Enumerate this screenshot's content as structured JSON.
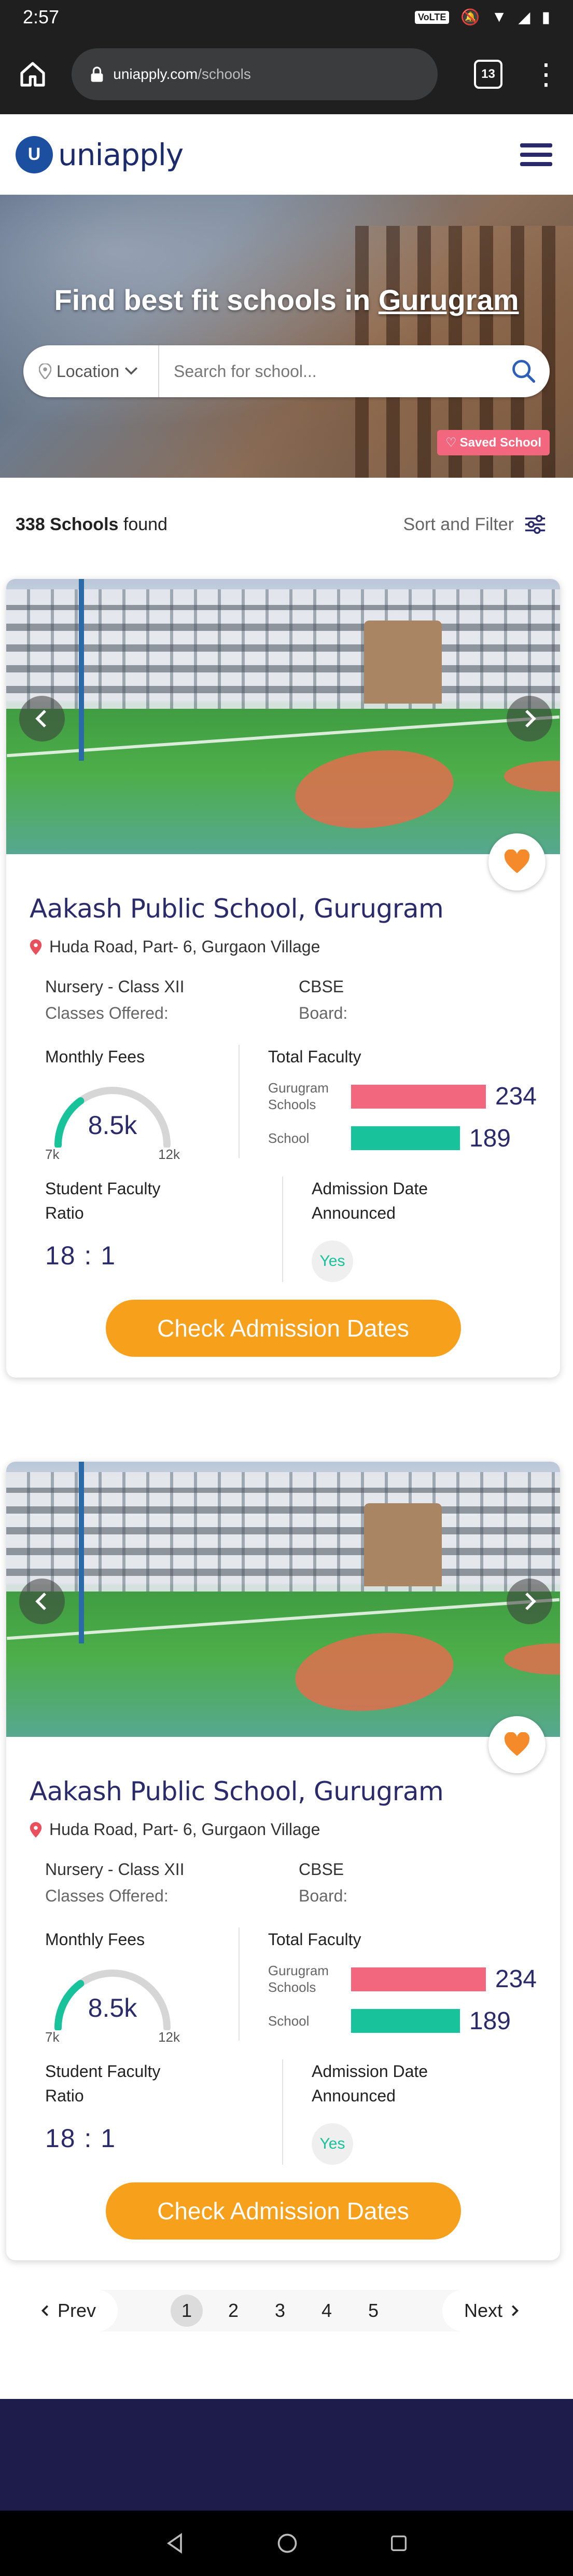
{
  "status_bar": {
    "time": "2:57",
    "network_badge": "VoLTE"
  },
  "browser": {
    "url_domain": "uniapply.com",
    "url_path": "/schools",
    "tab_count": "13"
  },
  "header": {
    "logo_mark": "U",
    "logo_text": "uniapply"
  },
  "hero": {
    "title_prefix": "Find best fit schools in ",
    "title_city": "Gurugram",
    "location_label": "Location",
    "search_placeholder": "Search for school...",
    "saved_label": "Saved School"
  },
  "results": {
    "count": "338 Schools",
    "count_suffix": "found",
    "sort_filter_label": "Sort and Filter"
  },
  "cards": [
    {
      "name": "Aakash Public School, Gurugram",
      "address": "Huda Road, Part- 6, Gurgaon Village",
      "classes": "Nursery - Class XII",
      "classes_label": "Classes Offered:",
      "board": "CBSE",
      "board_label": "Board:",
      "fees_label": "Monthly Fees",
      "fees_value": "8.5k",
      "fees_min": "7k",
      "fees_max": "12k",
      "fees_fraction": 0.3,
      "faculty_label": "Total Faculty",
      "gurugram_label": "Gurugram Schools",
      "gurugram_value": 234,
      "school_label": "School",
      "school_value": 189,
      "ratio_label": "Student Faculty Ratio",
      "ratio_value": "18 : 1",
      "admission_label": "Admission Date Announced",
      "admission_value": "Yes",
      "cta": "Check Admission Dates"
    },
    {
      "name": "Aakash Public School, Gurugram",
      "address": "Huda Road, Part- 6, Gurgaon Village",
      "classes": "Nursery - Class XII",
      "classes_label": "Classes Offered:",
      "board": "CBSE",
      "board_label": "Board:",
      "fees_label": "Monthly Fees",
      "fees_value": "8.5k",
      "fees_min": "7k",
      "fees_max": "12k",
      "fees_fraction": 0.3,
      "faculty_label": "Total Faculty",
      "gurugram_label": "Gurugram Schools",
      "gurugram_value": 234,
      "school_label": "School",
      "school_value": 189,
      "ratio_label": "Student Faculty Ratio",
      "ratio_value": "18 : 1",
      "admission_label": "Admission Date Announced",
      "admission_value": "Yes",
      "cta": "Check Admission Dates"
    }
  ],
  "pagination": {
    "prev": "Prev",
    "next": "Next",
    "pages": [
      "1",
      "2",
      "3",
      "4",
      "5"
    ],
    "current": "1"
  },
  "colors": {
    "brand_navy": "#2b2b6b",
    "accent_orange": "#f7a01b",
    "teal": "#18c29a",
    "pink": "#f2677e"
  }
}
